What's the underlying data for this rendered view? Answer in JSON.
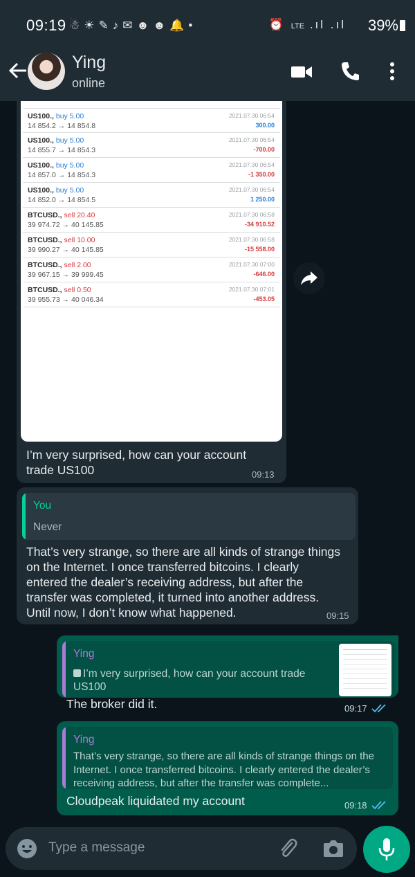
{
  "status_bar": {
    "time": "09:19",
    "battery": "39%",
    "network": "LTE"
  },
  "header": {
    "contact_name": "Ying",
    "contact_status": "online",
    "icons": [
      "back-arrow-icon",
      "video-call-icon",
      "phone-icon",
      "more-options-icon"
    ]
  },
  "trades": [
    {
      "symbol": "US100.,",
      "side": "buy 5.00",
      "type": "buy",
      "prices": "14 854.2 → 14 854.8",
      "date": "2021.07.30 06:54",
      "profit": "300.00",
      "positive": true
    },
    {
      "symbol": "US100.,",
      "side": "buy 5.00",
      "type": "buy",
      "prices": "14 855.7 → 14 854.3",
      "date": "2021.07.30 06:54",
      "profit": "-700.00",
      "positive": false
    },
    {
      "symbol": "US100.,",
      "side": "buy 5.00",
      "type": "buy",
      "prices": "14 857.0 → 14 854.3",
      "date": "2021.07.30 06:54",
      "profit": "-1 350.00",
      "positive": false
    },
    {
      "symbol": "US100.,",
      "side": "buy 5.00",
      "type": "buy",
      "prices": "14 852.0 → 14 854.5",
      "date": "2021.07.30 06:54",
      "profit": "1 250.00",
      "positive": true
    },
    {
      "symbol": "BTCUSD.,",
      "side": "sell 20.40",
      "type": "sell",
      "prices": "39 974.72 → 40 145.85",
      "date": "2021.07.30 06:58",
      "profit": "-34 910.52",
      "positive": false
    },
    {
      "symbol": "BTCUSD.,",
      "side": "sell 10.00",
      "type": "sell",
      "prices": "39 990.27 → 40 145.85",
      "date": "2021.07.30 06:58",
      "profit": "-15 558.00",
      "positive": false
    },
    {
      "symbol": "BTCUSD.,",
      "side": "sell 2.00",
      "type": "sell",
      "prices": "39 967.15 → 39 999.45",
      "date": "2021.07.30 07:00",
      "profit": "-646.00",
      "positive": false
    },
    {
      "symbol": "BTCUSD.,",
      "side": "sell 0.50",
      "type": "sell",
      "prices": "39 955.73 → 40 046.34",
      "date": "2021.07.30 07:01",
      "profit": "-453.05",
      "positive": false
    }
  ],
  "messages": {
    "m1": {
      "caption": "I’m very surprised, how can your account trade US100",
      "time": "09:13"
    },
    "m2": {
      "quote_author": "You",
      "quote_text": "Never",
      "text": "That’s very strange, so there are all kinds of strange things on the Internet. I once transferred bitcoins. I clearly entered the dealer’s receiving address, but after the transfer was completed, it turned into another address. Until now, I don’t know what happened.",
      "time": "09:15"
    },
    "m3": {
      "quote_author": "Ying",
      "quote_text": "I’m very surprised, how can your account trade US100",
      "text": "The broker did it.",
      "time": "09:17"
    },
    "m4": {
      "quote_author": "Ying",
      "quote_text": "That’s very strange, so there are all kinds of strange things on the Internet. I once transferred bitcoins. I clearly entered the dealer’s receiving address, but after the transfer was complete...",
      "text": "Cloudpeak liquidated my account",
      "time": "09:18"
    }
  },
  "input": {
    "placeholder": "Type a message"
  },
  "colors": {
    "incoming_bubble": "#1f2c34",
    "outgoing_bubble": "#005c4b",
    "accent": "#00a884",
    "you_quote": "#06cf9c",
    "ying_quote": "#a97bd6",
    "read_ticks": "#53bdeb"
  }
}
